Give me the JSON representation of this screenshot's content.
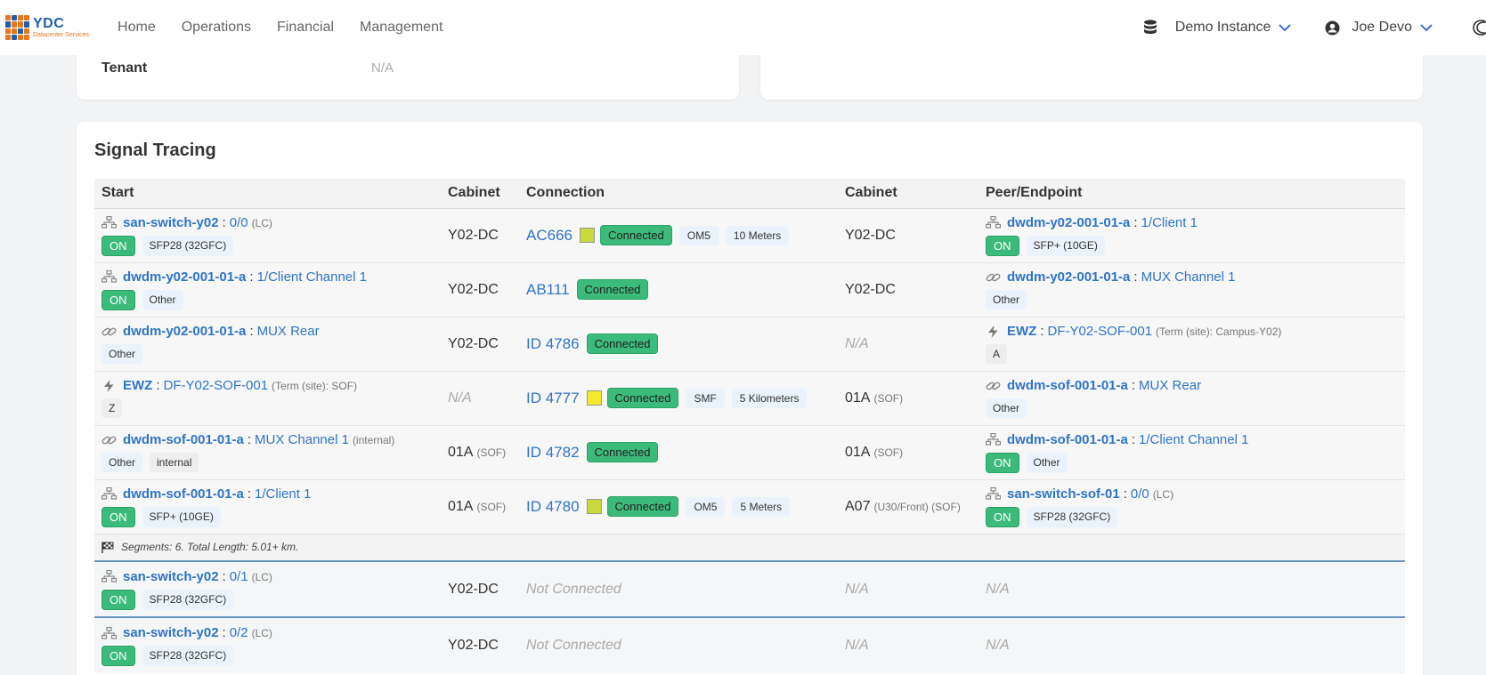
{
  "brand": {
    "name": "YDC",
    "sub": "Datacenter Services"
  },
  "nav": {
    "links": [
      "Home",
      "Operations",
      "Financial",
      "Management"
    ],
    "instance": "Demo Instance",
    "user": "Joe Devo"
  },
  "tenant": {
    "label": "Tenant",
    "value": "N/A"
  },
  "section_title": "Signal Tracing",
  "headers": [
    "Start",
    "Cabinet",
    "Connection",
    "Cabinet",
    "Peer/Endpoint"
  ],
  "colors": {
    "connected": "#3cba7c",
    "on": "#3cba7c",
    "link": "#2f74c8",
    "swatch_lime": "#c9d93b",
    "swatch_yellow": "#f5e82e"
  },
  "rows": [
    {
      "start": {
        "icon": "network-icon",
        "device": "san-switch-y02",
        "port": "0/0",
        "hint": "(LC)",
        "badges": [
          "ON",
          "SFP28 (32GFC)"
        ]
      },
      "cab1": "Y02-DC",
      "cab1_hint": "",
      "conn": {
        "id": "AC666",
        "swatch": "lime",
        "status": "Connected",
        "specs": [
          "OM5",
          "10 Meters"
        ]
      },
      "cab2": "Y02-DC",
      "cab2_hint": "",
      "peer": {
        "icon": "network-icon",
        "device": "dwdm-y02-001-01-a",
        "port": "1/Client 1",
        "hint": "",
        "badges": [
          "ON",
          "SFP+ (10GE)"
        ]
      }
    },
    {
      "start": {
        "icon": "network-icon",
        "device": "dwdm-y02-001-01-a",
        "port": "1/Client Channel 1",
        "hint": "",
        "badges": [
          "ON",
          "Other"
        ]
      },
      "cab1": "Y02-DC",
      "cab1_hint": "",
      "conn": {
        "id": "AB111",
        "swatch": "",
        "status": "Connected",
        "specs": []
      },
      "cab2": "Y02-DC",
      "cab2_hint": "",
      "peer": {
        "icon": "link-icon",
        "device": "dwdm-y02-001-01-a",
        "port": "MUX Channel 1",
        "hint": "",
        "badges": [
          "Other"
        ]
      }
    },
    {
      "start": {
        "icon": "link-icon",
        "device": "dwdm-y02-001-01-a",
        "port": "MUX Rear",
        "hint": "",
        "badges": [
          "Other"
        ]
      },
      "cab1": "Y02-DC",
      "cab1_hint": "",
      "conn": {
        "id": "ID 4786",
        "swatch": "",
        "status": "Connected",
        "specs": []
      },
      "cab2": "N/A",
      "cab2_hint": "",
      "peer": {
        "icon": "bolt-icon",
        "device": "EWZ",
        "port": "DF-Y02-SOF-001",
        "hint": "(Term (site): Campus-Y02)",
        "badges": [
          "A"
        ]
      }
    },
    {
      "start": {
        "icon": "bolt-icon",
        "device": "EWZ",
        "port": "DF-Y02-SOF-001",
        "hint": "(Term (site): SOF)",
        "badges": [
          "Z"
        ]
      },
      "cab1": "N/A",
      "cab1_hint": "",
      "conn": {
        "id": "ID 4777",
        "swatch": "yellow",
        "status": "Connected",
        "specs": [
          "SMF",
          "5 Kilometers"
        ]
      },
      "cab2": "01A",
      "cab2_hint": "(SOF)",
      "peer": {
        "icon": "link-icon",
        "device": "dwdm-sof-001-01-a",
        "port": "MUX Rear",
        "hint": "",
        "badges": [
          "Other"
        ]
      }
    },
    {
      "start": {
        "icon": "link-icon",
        "device": "dwdm-sof-001-01-a",
        "port": "MUX Channel 1",
        "hint": "(internal)",
        "badges": [
          "Other",
          "internal"
        ]
      },
      "cab1": "01A",
      "cab1_hint": "(SOF)",
      "conn": {
        "id": "ID 4782",
        "swatch": "",
        "status": "Connected",
        "specs": []
      },
      "cab2": "01A",
      "cab2_hint": "(SOF)",
      "peer": {
        "icon": "network-icon",
        "device": "dwdm-sof-001-01-a",
        "port": "1/Client Channel 1",
        "hint": "",
        "badges": [
          "ON",
          "Other"
        ]
      }
    },
    {
      "start": {
        "icon": "network-icon",
        "device": "dwdm-sof-001-01-a",
        "port": "1/Client 1",
        "hint": "",
        "badges": [
          "ON",
          "SFP+ (10GE)"
        ]
      },
      "cab1": "01A",
      "cab1_hint": "(SOF)",
      "conn": {
        "id": "ID 4780",
        "swatch": "lime",
        "status": "Connected",
        "specs": [
          "OM5",
          "5 Meters"
        ]
      },
      "cab2": "A07",
      "cab2_hint": "(U30/Front) (SOF)",
      "peer": {
        "icon": "network-icon",
        "device": "san-switch-sof-01",
        "port": "0/0",
        "hint": "(LC)",
        "badges": [
          "ON",
          "SFP28 (32GFC)"
        ]
      }
    }
  ],
  "summary": "Segments: 6. Total Length: 5.01+ km.",
  "singles": [
    {
      "device": "san-switch-y02",
      "port": "0/1",
      "hint": "(LC)",
      "badges": [
        "ON",
        "SFP28 (32GFC)"
      ],
      "cab1": "Y02-DC",
      "conn": "Not Connected",
      "cab2": "N/A",
      "peer": "N/A"
    },
    {
      "device": "san-switch-y02",
      "port": "0/2",
      "hint": "(LC)",
      "badges": [
        "ON",
        "SFP28 (32GFC)"
      ],
      "cab1": "Y02-DC",
      "conn": "Not Connected",
      "cab2": "N/A",
      "peer": "N/A"
    }
  ]
}
